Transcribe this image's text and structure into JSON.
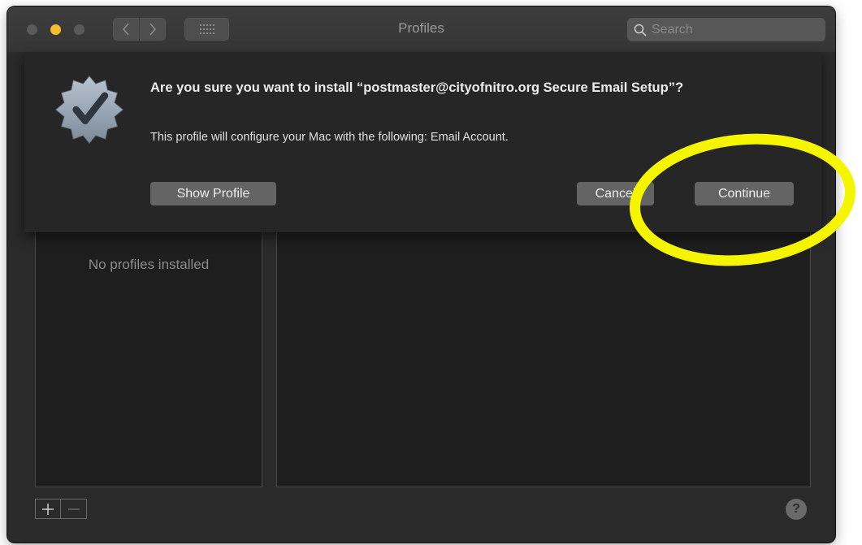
{
  "window": {
    "title": "Profiles",
    "search_placeholder": "Search"
  },
  "toolbar": {
    "back_icon": "chevron-left-icon",
    "forward_icon": "chevron-right-icon",
    "grid_icon": "grid-icon",
    "search_icon": "search-icon"
  },
  "sheet": {
    "icon": "verified-badge-icon",
    "title": "Are you sure you want to install “postmaster@cityofnitro.org Secure Email Setup”?",
    "message": "This profile will configure your Mac with the following: Email Account.",
    "show_profile_label": "Show Profile",
    "cancel_label": "Cancel",
    "continue_label": "Continue"
  },
  "profiles_list": {
    "empty_text": "No profiles installed"
  },
  "bottom": {
    "add_label": "+",
    "remove_label": "−",
    "help_label": "?"
  },
  "colors": {
    "window_bg": "#2a2a2a",
    "pane_bg": "#1e1e1e",
    "button_bg": "#646464",
    "highlight": "#f5f500",
    "minimize": "#f5bd2e"
  }
}
